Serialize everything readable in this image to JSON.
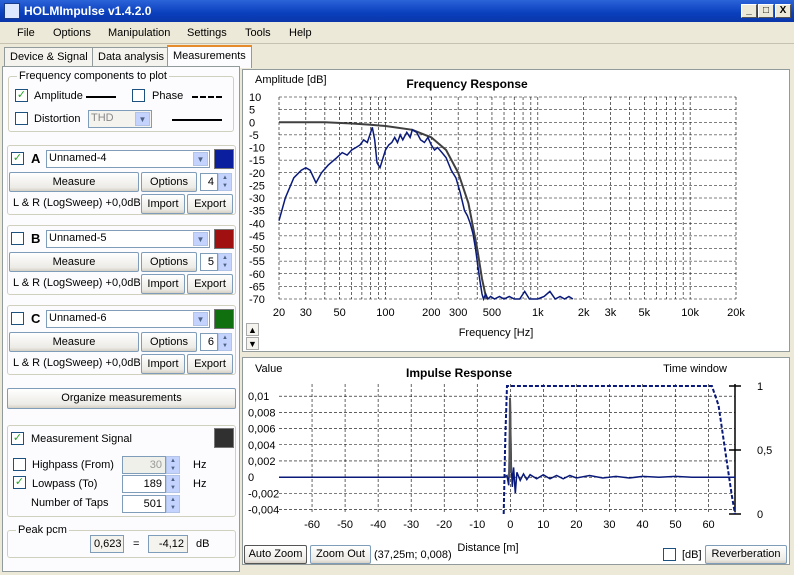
{
  "window": {
    "title": "HOLMImpulse  v1.4.2.0",
    "min": "_",
    "max": "□",
    "close": "X"
  },
  "menu": [
    "File",
    "Options",
    "Manipulation",
    "Settings",
    "Tools",
    "Help"
  ],
  "tabs": [
    "Device & Signal",
    "Data analysis",
    "Measurements"
  ],
  "freq_components": {
    "label": "Frequency components to plot",
    "amplitude": "Amplitude",
    "phase": "Phase",
    "distortion": "Distortion",
    "distortion_value": "THD",
    "amplitude_checked": "✓"
  },
  "measurements": [
    {
      "letter": "A",
      "name": "Unnamed-4",
      "checked": "✓",
      "color": "#0a1e9e",
      "measure": "Measure",
      "options": "Options",
      "count": "4",
      "signal": "L & R (LogSweep) +0,0dB",
      "import": "Import",
      "export": "Export"
    },
    {
      "letter": "B",
      "name": "Unnamed-5",
      "checked": "",
      "color": "#a01010",
      "measure": "Measure",
      "options": "Options",
      "count": "5",
      "signal": "L & R (LogSweep) +0,0dB",
      "import": "Import",
      "export": "Export"
    },
    {
      "letter": "C",
      "name": "Unnamed-6",
      "checked": "",
      "color": "#107010",
      "measure": "Measure",
      "options": "Options",
      "count": "6",
      "signal": "L & R (LogSweep) +0,0dB",
      "import": "Import",
      "export": "Export"
    }
  ],
  "organize": "Organize measurements",
  "meas_signal": {
    "label": "Measurement Signal",
    "checked": "✓",
    "highpass": "Highpass (From)",
    "highpass_value": "30",
    "highpass_unit": "Hz",
    "lowpass": "Lowpass (To)",
    "lowpass_value": "189",
    "lowpass_unit": "Hz",
    "lowpass_checked": "✓",
    "taps": "Number of Taps",
    "taps_value": "501"
  },
  "peak": {
    "label": "Peak pcm",
    "value": "0,623",
    "eq": "=",
    "db": "-4,12",
    "unit": "dB"
  },
  "freq_chart": {
    "title": "Frequency Response",
    "ylabel": "Amplitude [dB]",
    "xlabel": "Frequency [Hz]",
    "yticks": [
      "10",
      "5",
      "0",
      "-5",
      "-10",
      "-15",
      "-20",
      "-25",
      "-30",
      "-35",
      "-40",
      "-45",
      "-50",
      "-55",
      "-60",
      "-65",
      "-70"
    ],
    "xticks": [
      "20",
      "30",
      "50",
      "100",
      "200",
      "300",
      "500",
      "1k",
      "2k",
      "3k",
      "5k",
      "10k",
      "20k"
    ]
  },
  "imp_chart": {
    "title": "Impulse Response",
    "ylabel": "Value",
    "xlabel": "Distance [m]",
    "rlabel": "Time window",
    "yticks": [
      "0,01",
      "0,008",
      "0,006",
      "0,004",
      "0,002",
      "0",
      "-0,002",
      "-0,004"
    ],
    "xticks": [
      "-60",
      "-50",
      "-40",
      "-30",
      "-20",
      "-10",
      "0",
      "10",
      "20",
      "30",
      "40",
      "50",
      "60"
    ],
    "rticks": [
      "1",
      "0,5",
      "0"
    ]
  },
  "bottom": {
    "autozoom": "Auto Zoom",
    "zoomout": "Zoom Out",
    "coords": "(37,25m; 0,008)",
    "db": "[dB]",
    "reverb": "Reverberation"
  },
  "colors": {
    "accent": "#0a36a8",
    "trace": "#0a1a7a",
    "smooth": "#404040"
  }
}
